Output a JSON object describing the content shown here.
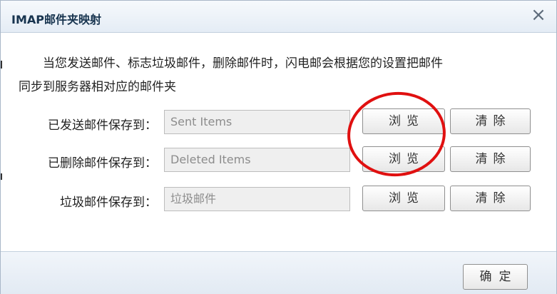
{
  "dialog": {
    "title": "IMAP邮件夹映射",
    "close_symbol": "×",
    "description_line1": "当您发送邮件、标志垃圾邮件，删除邮件时，闪电邮会根据您的设置把邮件",
    "description_line2": "同步到服务器相对应的邮件夹"
  },
  "rows": [
    {
      "label": "已发送邮件保存到：",
      "value": "Sent Items",
      "browse": "浏览",
      "clear": "清除"
    },
    {
      "label": "已删除邮件保存到：",
      "value": "Deleted Items",
      "browse": "浏览",
      "clear": "清除"
    },
    {
      "label": "垃圾邮件保存到：",
      "value": "垃圾邮件",
      "browse": "浏览",
      "clear": "清除"
    }
  ],
  "footer": {
    "ok_label": "确定"
  },
  "colors": {
    "annotation": "#e01010",
    "title_text": "#17344f",
    "field_background": "#efefef"
  },
  "icons": {
    "close": "close-icon"
  }
}
